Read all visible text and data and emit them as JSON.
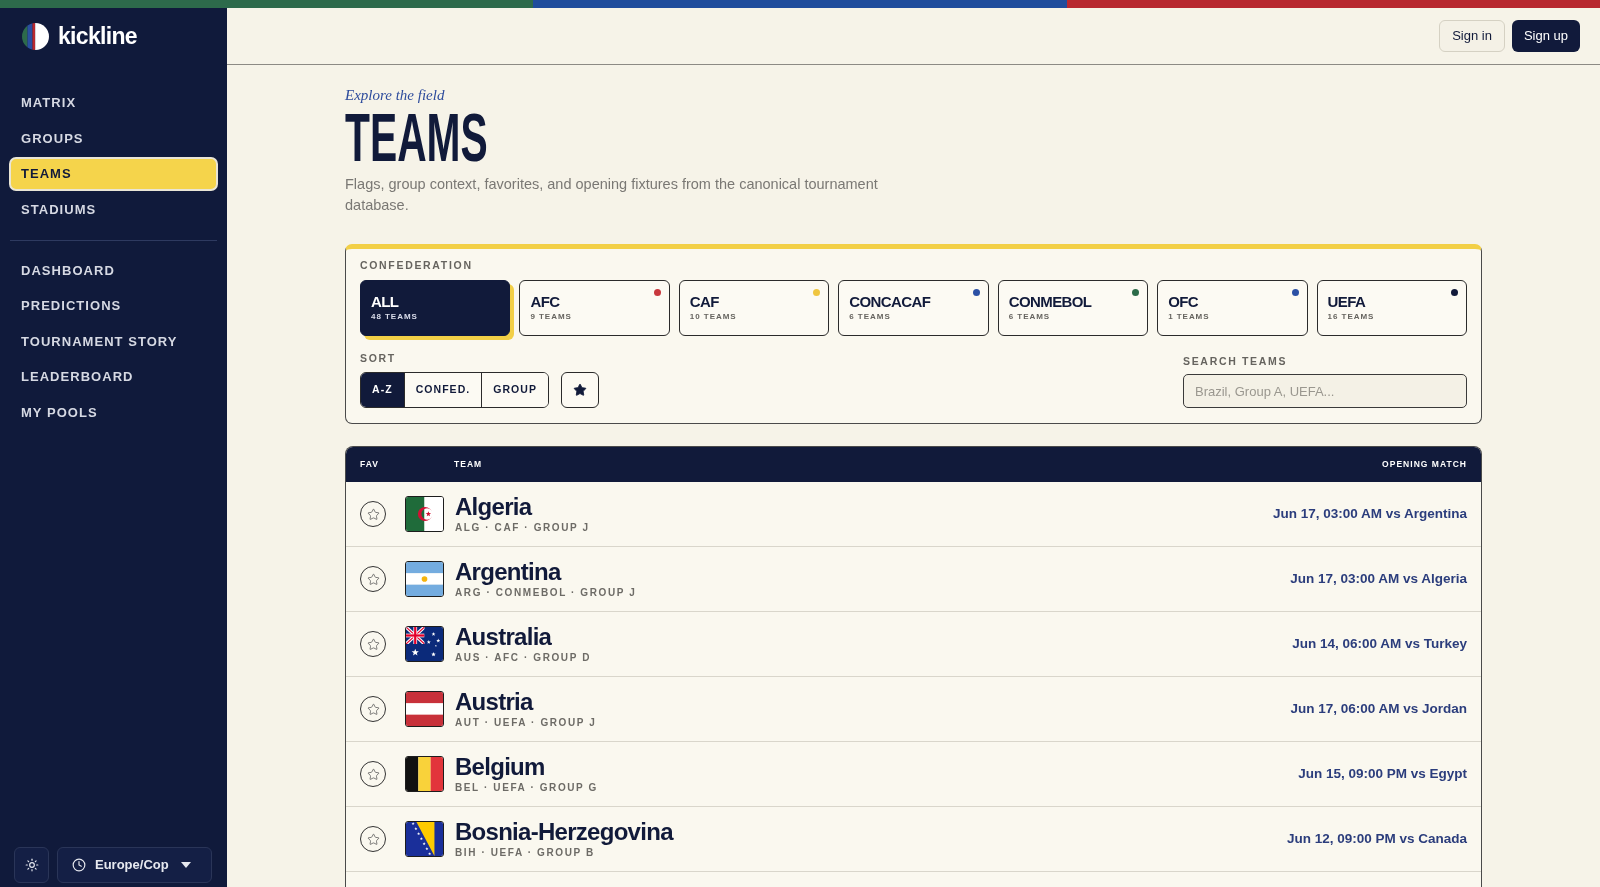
{
  "brand": {
    "name": "kickline"
  },
  "top_bar": {
    "sign_in": "Sign in",
    "sign_up": "Sign up"
  },
  "sidebar": {
    "primary": [
      {
        "label": "MATRIX",
        "selected": false
      },
      {
        "label": "GROUPS",
        "selected": false
      },
      {
        "label": "TEAMS",
        "selected": true
      },
      {
        "label": "STADIUMS",
        "selected": false
      }
    ],
    "secondary": [
      {
        "label": "DASHBOARD",
        "selected": false
      },
      {
        "label": "PREDICTIONS",
        "selected": false
      },
      {
        "label": "TOURNAMENT STORY",
        "selected": false
      },
      {
        "label": "LEADERBOARD",
        "selected": false
      },
      {
        "label": "MY POOLS",
        "selected": false
      }
    ],
    "timezone": {
      "value": "Europe/Cop"
    }
  },
  "page": {
    "eyebrow": "Explore the field",
    "title": "TEAMS",
    "description": "Flags, group context, favorites, and opening fixtures from the canonical tournament database."
  },
  "filters": {
    "confederation_label": "CONFEDERATION",
    "confederations": [
      {
        "name": "ALL",
        "count": "48 TEAMS",
        "selected": true
      },
      {
        "name": "AFC",
        "count": "9 TEAMS",
        "selected": false,
        "color": "#c8373d"
      },
      {
        "name": "CAF",
        "count": "10 TEAMS",
        "selected": false,
        "color": "#efc53f"
      },
      {
        "name": "CONCACAF",
        "count": "6 TEAMS",
        "selected": false,
        "color": "#2b50a5"
      },
      {
        "name": "CONMEBOL",
        "count": "6 TEAMS",
        "selected": false,
        "color": "#2b6a48"
      },
      {
        "name": "OFC",
        "count": "1 TEAMS",
        "selected": false,
        "color": "#2b50a5"
      },
      {
        "name": "UEFA",
        "count": "16 TEAMS",
        "selected": false,
        "color": "#111a3a"
      }
    ],
    "sort_label": "SORT",
    "sort_options": [
      {
        "label": "A-Z",
        "selected": true
      },
      {
        "label": "CONFED.",
        "selected": false
      },
      {
        "label": "GROUP",
        "selected": false
      }
    ],
    "favorites_only": false,
    "search": {
      "label": "SEARCH TEAMS",
      "placeholder": "Brazil, Group A, UEFA..."
    }
  },
  "table": {
    "columns": [
      "FAV",
      "TEAM",
      "OPENING MATCH"
    ],
    "rows": [
      {
        "favorite": false,
        "name": "Algeria",
        "meta": "ALG · CAF · GROUP J",
        "opening_match": "Jun 17, 03:00 AM vs Argentina"
      },
      {
        "favorite": false,
        "name": "Argentina",
        "meta": "ARG · CONMEBOL · GROUP J",
        "opening_match": "Jun 17, 03:00 AM vs Algeria"
      },
      {
        "favorite": false,
        "name": "Australia",
        "meta": "AUS · AFC · GROUP D",
        "opening_match": "Jun 14, 06:00 AM vs Turkey"
      },
      {
        "favorite": false,
        "name": "Austria",
        "meta": "AUT · UEFA · GROUP J",
        "opening_match": "Jun 17, 06:00 AM vs Jordan"
      },
      {
        "favorite": false,
        "name": "Belgium",
        "meta": "BEL · UEFA · GROUP G",
        "opening_match": "Jun 15, 09:00 PM vs Egypt"
      },
      {
        "favorite": false,
        "name": "Bosnia-Herzegovina",
        "meta": "BIH · UEFA · GROUP B",
        "opening_match": "Jun 12, 09:00 PM vs Canada"
      }
    ]
  }
}
